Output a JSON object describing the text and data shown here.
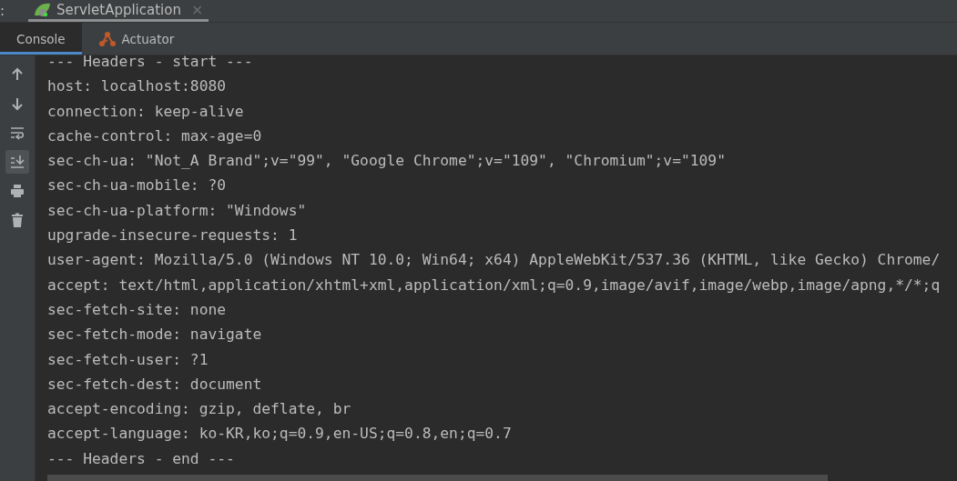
{
  "run_bar": {
    "prefix": ":",
    "tab": {
      "title": "ServletApplication",
      "close": "×"
    }
  },
  "tool_tabs": [
    {
      "label": "Console",
      "selected": true,
      "kind": "console"
    },
    {
      "label": "Actuator",
      "selected": false,
      "kind": "actuator"
    }
  ],
  "toolbar": [
    {
      "kind": "up",
      "selected": false
    },
    {
      "kind": "down",
      "selected": false
    },
    {
      "kind": "wrap",
      "selected": false
    },
    {
      "kind": "scroll-end",
      "selected": true
    },
    {
      "kind": "print",
      "selected": false
    },
    {
      "kind": "trash",
      "selected": false
    }
  ],
  "console_lines": [
    "--- Headers - start ---",
    "host: localhost:8080",
    "connection: keep-alive",
    "cache-control: max-age=0",
    "sec-ch-ua: \"Not_A Brand\";v=\"99\", \"Google Chrome\";v=\"109\", \"Chromium\";v=\"109\"",
    "sec-ch-ua-mobile: ?0",
    "sec-ch-ua-platform: \"Windows\"",
    "upgrade-insecure-requests: 1",
    "user-agent: Mozilla/5.0 (Windows NT 10.0; Win64; x64) AppleWebKit/537.36 (KHTML, like Gecko) Chrome/",
    "accept: text/html,application/xhtml+xml,application/xml;q=0.9,image/avif,image/webp,image/apng,*/*;q",
    "sec-fetch-site: none",
    "sec-fetch-mode: navigate",
    "sec-fetch-user: ?1",
    "sec-fetch-dest: document",
    "accept-encoding: gzip, deflate, br",
    "accept-language: ko-KR,ko;q=0.9,en-US;q=0.8,en;q=0.7",
    "--- Headers - end ---"
  ]
}
